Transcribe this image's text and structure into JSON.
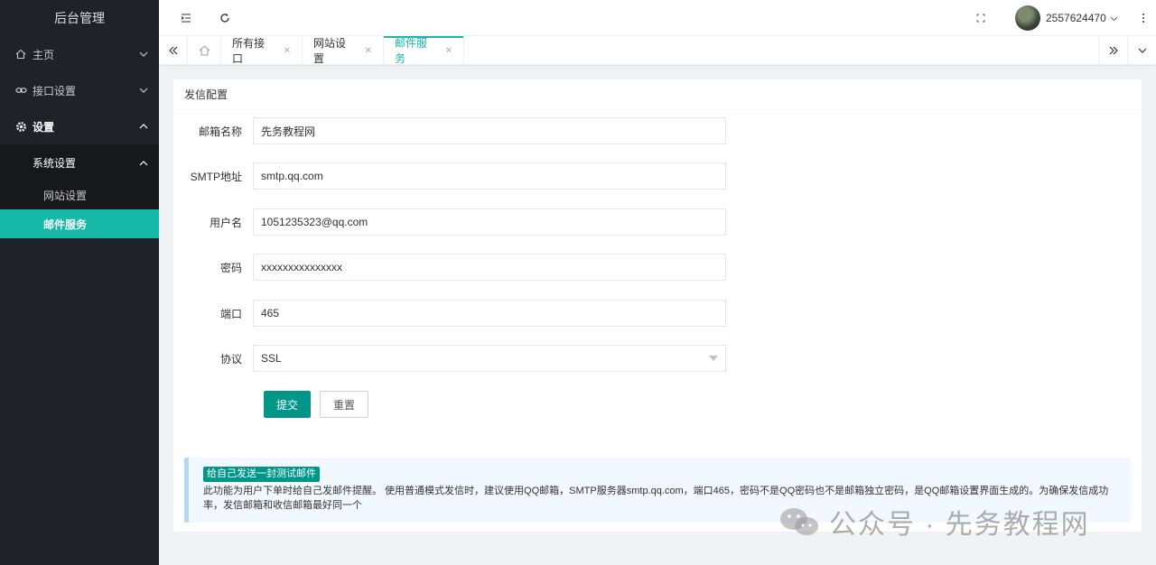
{
  "sidebar": {
    "logo": "后台管理",
    "items": [
      {
        "label": "主页",
        "icon": "home-icon"
      },
      {
        "label": "接口设置",
        "icon": "link-icon"
      },
      {
        "label": "设置",
        "icon": "gear-icon"
      }
    ],
    "submenu": {
      "label": "系统设置"
    },
    "sub_items": [
      {
        "label": "网站设置"
      },
      {
        "label": "邮件服务"
      }
    ]
  },
  "header": {
    "username": "2557624470"
  },
  "tabs": [
    {
      "label": "所有接口"
    },
    {
      "label": "网站设置"
    },
    {
      "label": "邮件服务"
    }
  ],
  "card": {
    "title": "发信配置",
    "fields": [
      {
        "label": "邮箱名称",
        "value": "先务教程网"
      },
      {
        "label": "SMTP地址",
        "value": "smtp.qq.com"
      },
      {
        "label": "用户名",
        "value": "1051235323@qq.com"
      },
      {
        "label": "密码",
        "value": "xxxxxxxxxxxxxxx"
      },
      {
        "label": "端口",
        "value": "465"
      },
      {
        "label": "协议",
        "value": "SSL"
      }
    ],
    "submit_label": "提交",
    "reset_label": "重置"
  },
  "notice": {
    "tag": "给自己发送一封测试邮件",
    "text": "此功能为用户下单时给自己发邮件提醒。 使用普通模式发信时，建议使用QQ邮箱，SMTP服务器smtp.qq.com，端口465，密码不是QQ密码也不是邮箱独立密码，是QQ邮箱设置界面生成的。为确保发信成功率，发信邮箱和收信邮箱最好同一个"
  },
  "watermark": "公众号 · 先务教程网",
  "colors": {
    "accent": "#16b9a8",
    "primary_button": "#009688",
    "sidebar_bg": "#20222a"
  }
}
